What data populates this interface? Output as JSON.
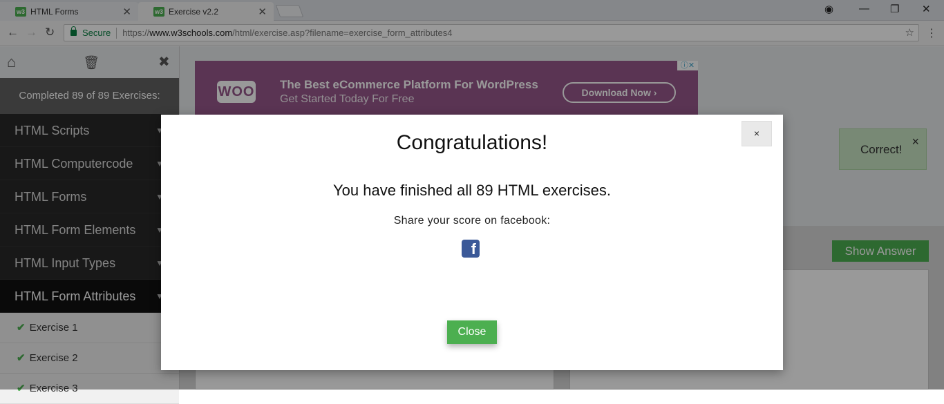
{
  "browser": {
    "tabs": [
      {
        "label": "HTML Forms",
        "favicon": "w3"
      },
      {
        "label": "Exercise v2.2",
        "favicon": "w3"
      }
    ],
    "secure_label": "Secure",
    "url_scheme": "https://",
    "url_host": "www.w3schools.com",
    "url_path": "/html/exercise.asp?filename=exercise_form_attributes4"
  },
  "sidebar": {
    "progress": "Completed 89 of 89 Exercises:",
    "items": [
      {
        "label": "HTML Scripts"
      },
      {
        "label": "HTML Computercode"
      },
      {
        "label": "HTML Forms"
      },
      {
        "label": "HTML Form Elements"
      },
      {
        "label": "HTML Input Types"
      },
      {
        "label": "HTML Form Attributes"
      }
    ],
    "subitems": [
      {
        "label": "Exercise 1"
      },
      {
        "label": "Exercise 2"
      },
      {
        "label": "Exercise 3"
      }
    ]
  },
  "ad": {
    "logo": "WOO",
    "title": "The Best eCommerce Platform For WordPress",
    "subtitle": "Get Started Today For Free",
    "button": "Download Now"
  },
  "main": {
    "correct": "Correct!",
    "show_answer": "Show Answer"
  },
  "modal": {
    "close_x": "×",
    "title": "Congratulations!",
    "message": "You have finished all 89 HTML exercises.",
    "share": "Share your score on facebook:",
    "close_button": "Close"
  },
  "colors": {
    "accent_green": "#4caf50",
    "ad_purple": "#96588a",
    "facebook_blue": "#3b5998"
  }
}
